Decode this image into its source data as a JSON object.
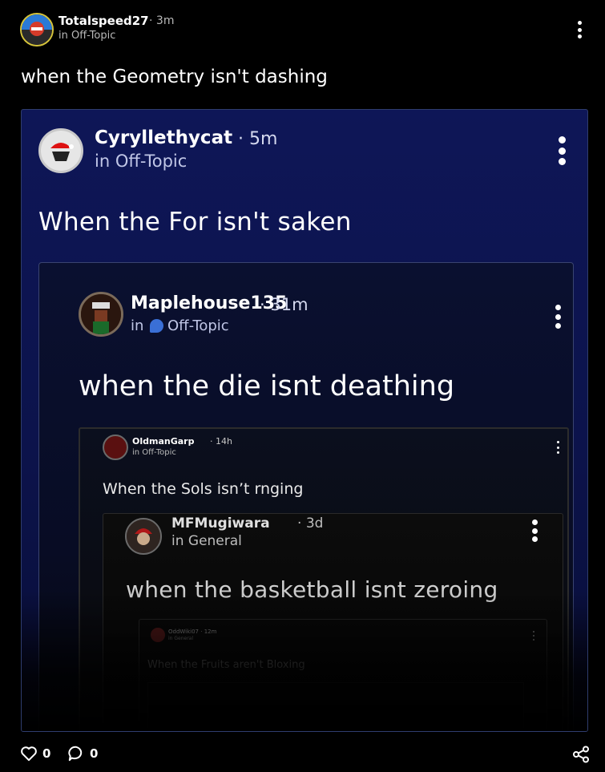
{
  "post": {
    "username": "Totalspeed27",
    "time": "3m",
    "category": "in Off-Topic",
    "title": "when the Geometry isn't dashing",
    "likes": "0",
    "comments": "0"
  },
  "embed1": {
    "username": "Cyryllethycat",
    "time": "5m",
    "category": "in Off-Topic",
    "title": "When the For isn't saken"
  },
  "embed2": {
    "username": "Maplehouse135",
    "time": "31m",
    "category_prefix": "in",
    "category": "Off-Topic",
    "title": "when the die isnt deathing"
  },
  "embed3": {
    "username": "OldmanGarp",
    "time": "14h",
    "category": "in Off-Topic",
    "title": "When the Sols isn’t rnging"
  },
  "embed4": {
    "username": "MFMugiwara",
    "time": "3d",
    "category": "in General",
    "title": "when the basketball isnt zeroing"
  },
  "embed5": {
    "username": "OddWiki07 · 12m",
    "category": "in General",
    "title": "When the Fruits aren't Bloxing"
  }
}
